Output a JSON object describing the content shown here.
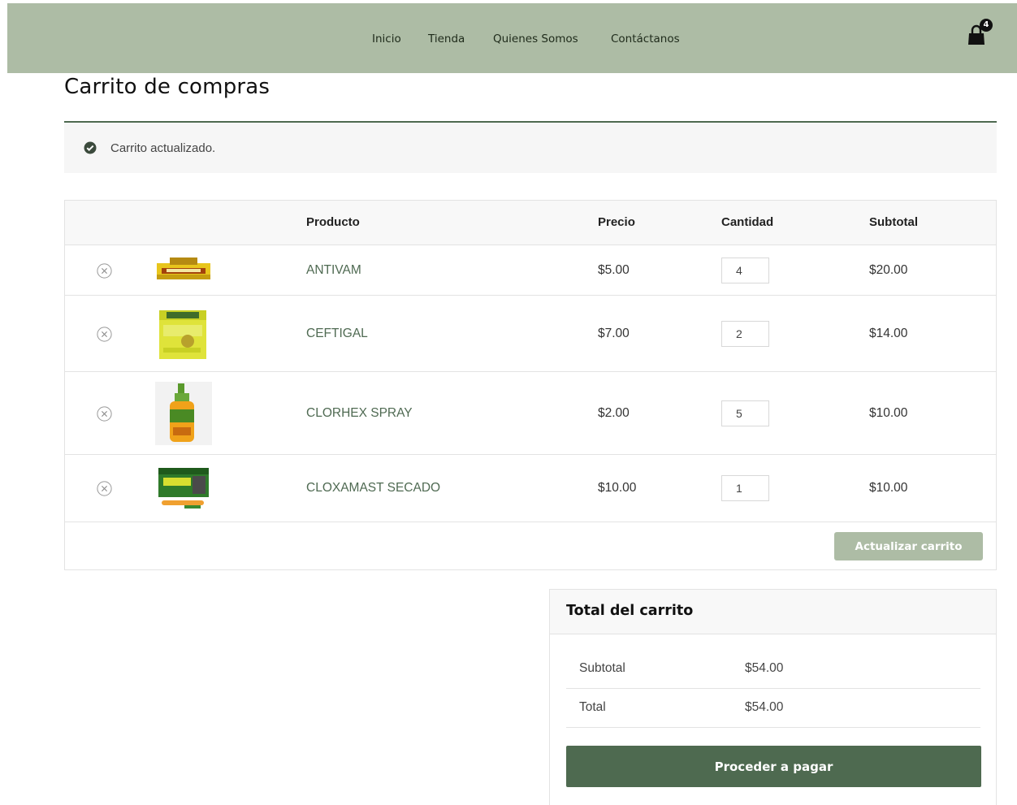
{
  "nav": {
    "items": [
      "Inicio",
      "Tienda",
      "Quienes Somos",
      "Contáctanos"
    ],
    "cart_count": "4"
  },
  "page": {
    "title": "Carrito de compras"
  },
  "notice": {
    "text": "Carrito actualizado.",
    "icon": "check-circle-icon"
  },
  "table": {
    "headers": {
      "product": "Producto",
      "price": "Precio",
      "quantity": "Cantidad",
      "subtotal": "Subtotal"
    },
    "rows": [
      {
        "name": "ANTIVAM",
        "price": "$5.00",
        "qty": "4",
        "subtotal": "$20.00"
      },
      {
        "name": "CEFTIGAL",
        "price": "$7.00",
        "qty": "2",
        "subtotal": "$14.00"
      },
      {
        "name": "CLORHEX SPRAY",
        "price": "$2.00",
        "qty": "5",
        "subtotal": "$10.00"
      },
      {
        "name": "CLOXAMAST SECADO",
        "price": "$10.00",
        "qty": "1",
        "subtotal": "$10.00"
      }
    ],
    "update_label": "Actualizar carrito"
  },
  "totals": {
    "title": "Total del carrito",
    "subtotal_label": "Subtotal",
    "subtotal_value": "$54.00",
    "total_label": "Total",
    "total_value": "$54.00",
    "checkout_label": "Proceder a pagar"
  },
  "colors": {
    "header_bg": "#adbca5",
    "accent": "#4e6a50",
    "link": "#4f6a52"
  }
}
